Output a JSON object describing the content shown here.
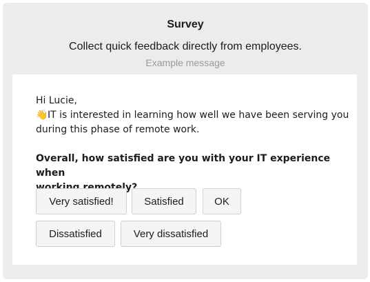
{
  "header": {
    "title": "Survey",
    "subtitle": "Collect quick feedback directly from employees.",
    "caption": "Example message"
  },
  "message": {
    "greeting": "Hi Lucie,",
    "emoji": "👋",
    "body_line1": "IT is interested in learning how well we have been serving you",
    "body_line2": "during this phase of remote work.",
    "question_line1": "Overall, how satisfied are you with your IT experience when",
    "question_line2": "working remotely?"
  },
  "options": [
    {
      "label": "Very satisfied!"
    },
    {
      "label": "Satisfied"
    },
    {
      "label": "OK"
    },
    {
      "label": "Dissatisfied"
    },
    {
      "label": "Very dissatisfied"
    }
  ]
}
